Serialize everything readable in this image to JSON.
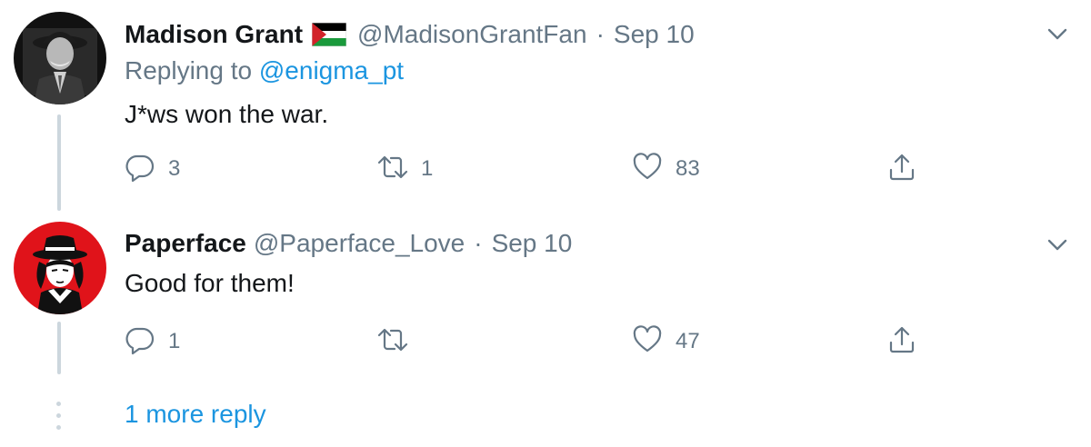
{
  "tweets": [
    {
      "name": "Madison Grant",
      "flag_icon": "palestine-flag-icon",
      "handle": "@MadisonGrantFan",
      "separator": "·",
      "date": "Sep 10",
      "replying_prefix": "Replying to",
      "replying_to": "@enigma_pt",
      "text": "J*ws won the war.",
      "replies": "3",
      "retweets": "1",
      "likes": "83"
    },
    {
      "name": "Paperface",
      "handle": "@Paperface_Love",
      "separator": "·",
      "date": "Sep 10",
      "text": "Good for them!",
      "replies": "1",
      "retweets": "",
      "likes": "47"
    }
  ],
  "more_replies_label": "1 more reply",
  "colors": {
    "text_primary": "#14171a",
    "text_secondary": "#657786",
    "link": "#1b95e0",
    "thread_line": "#ccd6dd",
    "avatar_red": "#e0131a"
  },
  "icons": [
    "chevron-down-icon",
    "reply-icon",
    "retweet-icon",
    "like-icon",
    "share-icon"
  ]
}
